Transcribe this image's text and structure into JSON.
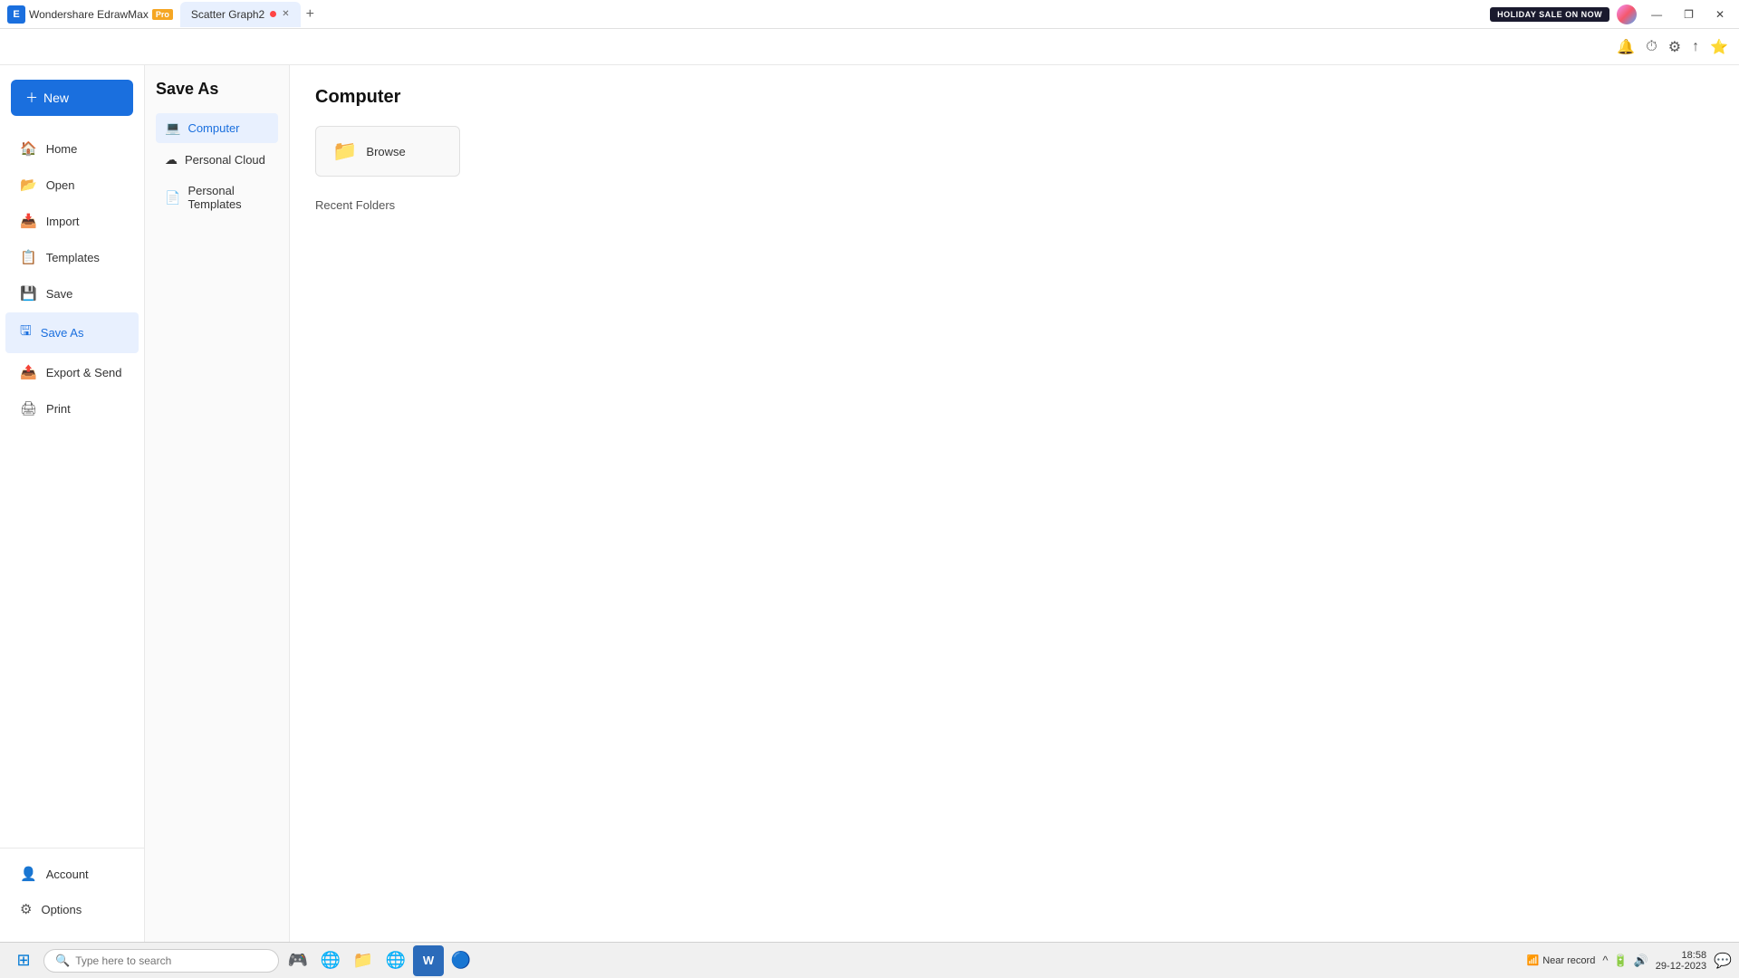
{
  "titleBar": {
    "appName": "Wondershare EdrawMax",
    "proBadge": "Pro",
    "tab": {
      "label": "Scatter Graph2",
      "hasDot": true
    },
    "tabAdd": "+",
    "holidayBadge": "HOLIDAY SALE ON NOW",
    "windowButtons": {
      "minimize": "—",
      "restore": "❐",
      "close": "✕"
    }
  },
  "toolbar": {
    "icons": [
      "🔔",
      "⏱",
      "⚙",
      "↑",
      "⭐"
    ]
  },
  "sidebar": {
    "newButton": "New",
    "items": [
      {
        "id": "home",
        "label": "Home",
        "icon": "🏠"
      },
      {
        "id": "open",
        "label": "Open",
        "icon": "📂"
      },
      {
        "id": "import",
        "label": "Import",
        "icon": "📥"
      },
      {
        "id": "templates",
        "label": "Templates",
        "icon": "📋"
      },
      {
        "id": "save",
        "label": "Save",
        "icon": "💾"
      },
      {
        "id": "save-as",
        "label": "Save As",
        "icon": "🖫",
        "active": true
      },
      {
        "id": "export",
        "label": "Export & Send",
        "icon": "📤"
      },
      {
        "id": "print",
        "label": "Print",
        "icon": "🖨"
      }
    ],
    "bottomItems": [
      {
        "id": "account",
        "label": "Account",
        "icon": "👤"
      },
      {
        "id": "options",
        "label": "Options",
        "icon": "⚙"
      }
    ]
  },
  "saveAsPanel": {
    "title": "Save As",
    "options": [
      {
        "id": "computer",
        "label": "Computer",
        "icon": "💻",
        "active": true
      },
      {
        "id": "personal-cloud",
        "label": "Personal Cloud",
        "icon": "☁"
      },
      {
        "id": "personal-templates",
        "label": "Personal Templates",
        "icon": "📄"
      }
    ]
  },
  "content": {
    "title": "Computer",
    "browseLabel": "Browse",
    "recentFoldersLabel": "Recent Folders"
  },
  "taskbar": {
    "searchPlaceholder": "Type here to search",
    "apps": [
      "⊞",
      "🔍",
      "🎮",
      "🌐",
      "📁",
      "🌐",
      "W",
      "🔵"
    ],
    "status": {
      "nearRecord": "Near record",
      "icon": "📶"
    },
    "time": "18:58",
    "date": "29-12-2023",
    "sysIcons": [
      "^",
      "🔋",
      "🔊",
      "💬"
    ]
  }
}
